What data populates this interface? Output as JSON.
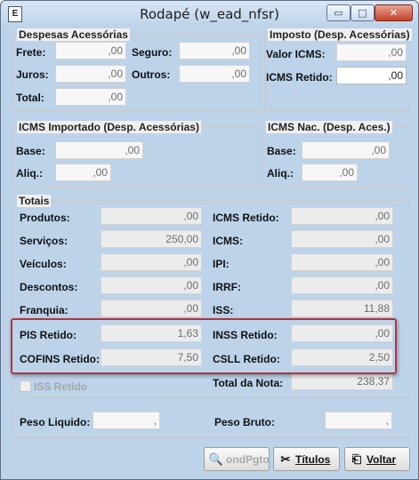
{
  "window": {
    "title": "Rodapé (w_ead_nfsr)",
    "icon_letter": "E",
    "min_glyph": "▭",
    "max_glyph": "□",
    "close_glyph": "✕"
  },
  "despesas": {
    "title": "Despesas Acessórias",
    "frete": {
      "label": "Frete:",
      "value": ",00"
    },
    "seguro": {
      "label": "Seguro:",
      "value": ",00"
    },
    "juros": {
      "label": "Juros:",
      "value": ",00"
    },
    "outros": {
      "label": "Outros:",
      "value": ",00"
    },
    "total": {
      "label": "Total:",
      "value": ",00"
    }
  },
  "imposto": {
    "title": "Imposto (Desp. Acessórias)",
    "valor_icms": {
      "label": "Valor ICMS:",
      "value": ",00"
    },
    "icms_retido": {
      "label": "ICMS Retido:",
      "value": ",00"
    }
  },
  "icms_importado": {
    "title": "ICMS Importado (Desp. Acessórias)",
    "base": {
      "label": "Base:",
      "value": ",00"
    },
    "aliq": {
      "label": "Aliq.:",
      "value": ",00"
    }
  },
  "icms_nac": {
    "title": "ICMS Nac. (Desp. Aces.)",
    "base": {
      "label": "Base:",
      "value": ",00"
    },
    "aliq": {
      "label": "Aliq.:",
      "value": ",00"
    }
  },
  "totais": {
    "title": "Totais",
    "left": [
      {
        "label": "Produtos:",
        "value": ",00"
      },
      {
        "label": "Serviços:",
        "value": "250,00"
      },
      {
        "label": "Veículos:",
        "value": ",00"
      },
      {
        "label": "Descontos:",
        "value": ",00"
      },
      {
        "label": "Franquia:",
        "value": ",00"
      },
      {
        "label": "PIS Retido:",
        "value": "1,63"
      },
      {
        "label": "COFINS Retido:",
        "value": "7,50"
      }
    ],
    "right": [
      {
        "label": "ICMS Retido:",
        "value": ",00"
      },
      {
        "label": "ICMS:",
        "value": ",00"
      },
      {
        "label": "IPI:",
        "value": ",00"
      },
      {
        "label": "IRRF:",
        "value": ",00"
      },
      {
        "label": "ISS:",
        "value": "11,88"
      },
      {
        "label": "INSS Retido:",
        "value": ",00"
      },
      {
        "label": "CSLL Retido:",
        "value": "2,50"
      },
      {
        "label": "Total da Nota:",
        "value": "238,37"
      }
    ],
    "iss_retido_label": "ISS Retido",
    "iss_retido_checked": false
  },
  "peso": {
    "liquido": {
      "label": "Peso Liquido:",
      "value": ","
    },
    "bruto": {
      "label": "Peso Bruto:",
      "value": ","
    }
  },
  "buttons": {
    "cond_pgto": {
      "label": "ondPgto",
      "icon": "🔍"
    },
    "titulos": {
      "label": "Títulos",
      "icon": "✂"
    },
    "voltar": {
      "label": "Voltar",
      "icon": "⎗"
    }
  },
  "colors": {
    "highlight_border": "#b3353c",
    "titlebar": "#bcd2e9",
    "close_button": "#c34128"
  }
}
